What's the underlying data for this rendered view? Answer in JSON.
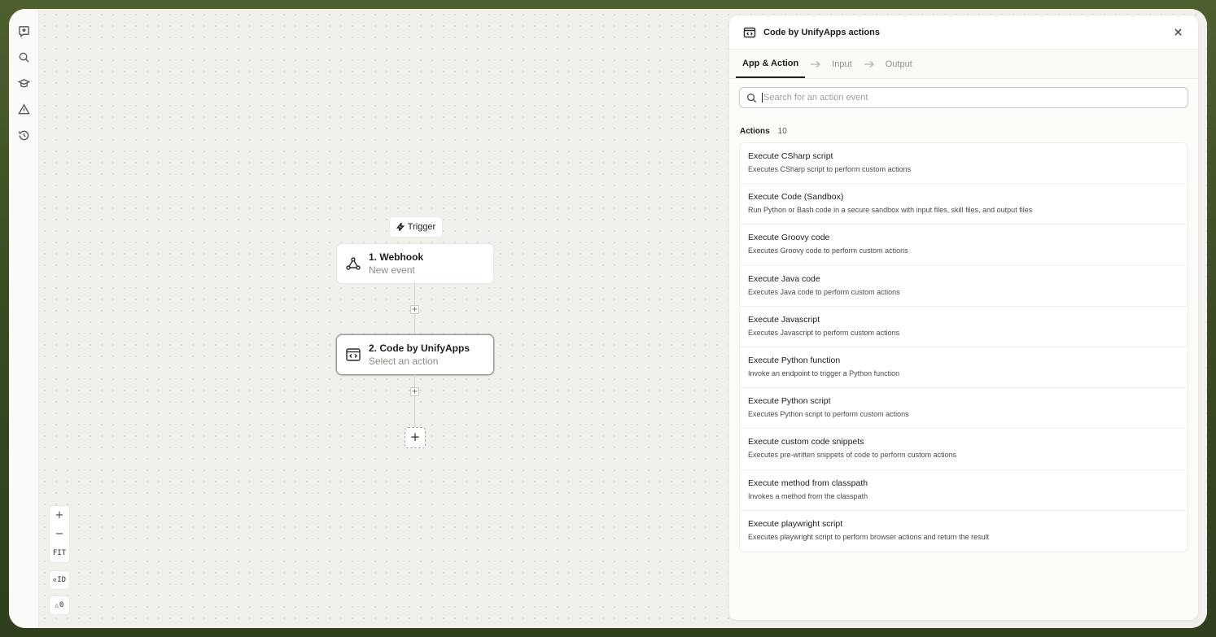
{
  "rail": {
    "icons": [
      "ai-assistant-icon",
      "search-icon",
      "learn-icon",
      "warning-icon",
      "history-icon"
    ]
  },
  "canvas": {
    "trigger_label": "Trigger",
    "nodes": [
      {
        "title": "1. Webhook",
        "subtitle": "New event",
        "icon": "webhook-icon"
      },
      {
        "title": "2. Code by UnifyApps",
        "subtitle": "Select an action",
        "icon": "code-icon"
      }
    ],
    "controls": {
      "zoom_in": "+",
      "zoom_out": "−",
      "fit": "FIT",
      "id_toggle": "ID",
      "warnings_count": "0"
    }
  },
  "panel": {
    "title": "Code by UnifyApps actions",
    "tabs": [
      {
        "label": "App & Action",
        "active": true
      },
      {
        "label": "Input",
        "active": false
      },
      {
        "label": "Output",
        "active": false
      }
    ],
    "search": {
      "placeholder": "Search for an action event",
      "value": ""
    },
    "actions_label": "Actions",
    "actions_count": "10",
    "actions": [
      {
        "title": "Execute CSharp script",
        "desc": "Executes CSharp script to perform custom actions"
      },
      {
        "title": "Execute Code (Sandbox)",
        "desc": "Run Python or Bash code in a secure sandbox with input files, skill files, and output files"
      },
      {
        "title": "Execute Groovy code",
        "desc": "Executes Groovy code to perform custom actions"
      },
      {
        "title": "Execute Java code",
        "desc": "Executes Java code to perform custom actions"
      },
      {
        "title": "Execute Javascript",
        "desc": "Executes Javascript to perform custom actions"
      },
      {
        "title": "Execute Python function",
        "desc": "Invoke an endpoint to trigger a Python function"
      },
      {
        "title": "Execute Python script",
        "desc": "Executes Python script to perform custom actions"
      },
      {
        "title": "Execute custom code snippets",
        "desc": "Executes pre-written snippets of code to perform custom actions"
      },
      {
        "title": "Execute method from classpath",
        "desc": "Invokes a method from the classpath"
      },
      {
        "title": "Execute playwright script",
        "desc": "Executes playwright script to perform browser actions and return the result"
      }
    ]
  }
}
